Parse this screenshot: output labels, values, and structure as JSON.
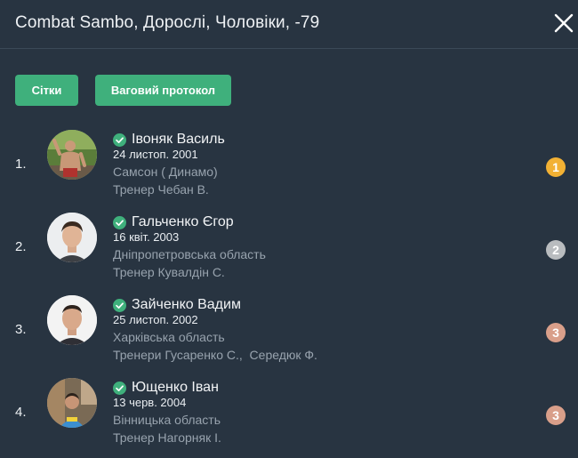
{
  "header": {
    "title": "Combat Sambo, Дорослі, Чоловіки, -79"
  },
  "actions": {
    "grids_label": "Сітки",
    "weigh_in_label": "Ваговий протокол"
  },
  "colors": {
    "background": "#283441",
    "accent_green": "#3fb07c",
    "gold": "#f2b134",
    "silver": "#b9bcbf",
    "bronze": "#d99f8a",
    "muted_text": "#98a3ae"
  },
  "results": [
    {
      "place": "1.",
      "name": "Івоняк Василь",
      "dob": "24 листоп. 2001",
      "club": "Самсон ( Динамо)",
      "coach": "Тренер Чебан В.",
      "medal": "1",
      "medal_color": "#f2b134",
      "verified": true
    },
    {
      "place": "2.",
      "name": "Гальченко Єгор",
      "dob": "16 квіт. 2003",
      "club": "Дніпропетровська область",
      "coach": "Тренер Кувалдін С.",
      "medal": "2",
      "medal_color": "#b9bcbf",
      "verified": true
    },
    {
      "place": "3.",
      "name": "Зайченко Вадим",
      "dob": "25 листоп. 2002",
      "club": "Харківська область",
      "coach": "Тренери Гусаренко С.,  Середюк Ф.",
      "medal": "3",
      "medal_color": "#d99f8a",
      "verified": true
    },
    {
      "place": "4.",
      "name": "Ющенко Іван",
      "dob": "13 черв. 2004",
      "club": "Вінницька область",
      "coach": "Тренер Нагорняк І.",
      "medal": "3",
      "medal_color": "#d99f8a",
      "verified": true
    }
  ]
}
